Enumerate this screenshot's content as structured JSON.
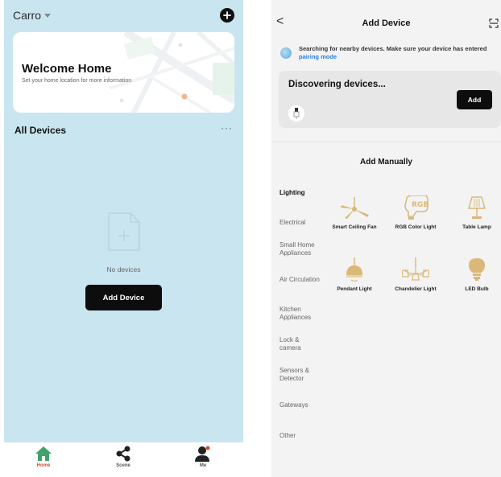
{
  "home": {
    "home_name": "Carro",
    "welcome_title": "Welcome Home",
    "welcome_subtitle": "Set your home location for more information",
    "all_devices_label": "All Devices",
    "more_label": "···",
    "empty_text": "No devices",
    "add_device_button": "Add Device",
    "tabs": [
      {
        "label": "Home",
        "icon": "home-icon",
        "active": true
      },
      {
        "label": "Scene",
        "icon": "share-icon",
        "active": false
      },
      {
        "label": "Me",
        "icon": "user-icon",
        "active": false
      }
    ],
    "colors": {
      "background": "#c9e6f0",
      "active_tab": "#e0462f",
      "home_icon": "#3fa36b"
    }
  },
  "add_device": {
    "back_label": "<",
    "title": "Add Device",
    "search_text": "Searching for nearby devices. Make sure your device has entered",
    "pairing_link": "pairing mode",
    "discovering_title": "Discovering devices...",
    "add_button": "Add",
    "add_manually_title": "Add Manually",
    "categories": [
      {
        "label": "Lighting",
        "active": true
      },
      {
        "label": "Electrical",
        "active": false
      },
      {
        "label": "Small Home Appliances",
        "active": false
      },
      {
        "label": "Air Circulation",
        "active": false
      },
      {
        "label": "Kitchen Appliances",
        "active": false
      },
      {
        "label": "Lock & camera",
        "active": false
      },
      {
        "label": "Sensors & Detector",
        "active": false
      },
      {
        "label": "Gateways",
        "active": false
      },
      {
        "label": "Other",
        "active": false
      }
    ],
    "devices": [
      {
        "label": "Smart Ceiling Fan",
        "icon": "ceiling-fan-icon"
      },
      {
        "label": "RGB Color Light",
        "icon": "rgb-bulb-icon"
      },
      {
        "label": "Table Lamp",
        "icon": "table-lamp-icon"
      },
      {
        "label": "Pendant Light",
        "icon": "pendant-light-icon"
      },
      {
        "label": "Chandelier Light",
        "icon": "chandelier-icon"
      },
      {
        "label": "LED Bulb",
        "icon": "led-bulb-icon"
      }
    ],
    "colors": {
      "icon_gold": "#d9b878",
      "link": "#2a7de1"
    }
  }
}
